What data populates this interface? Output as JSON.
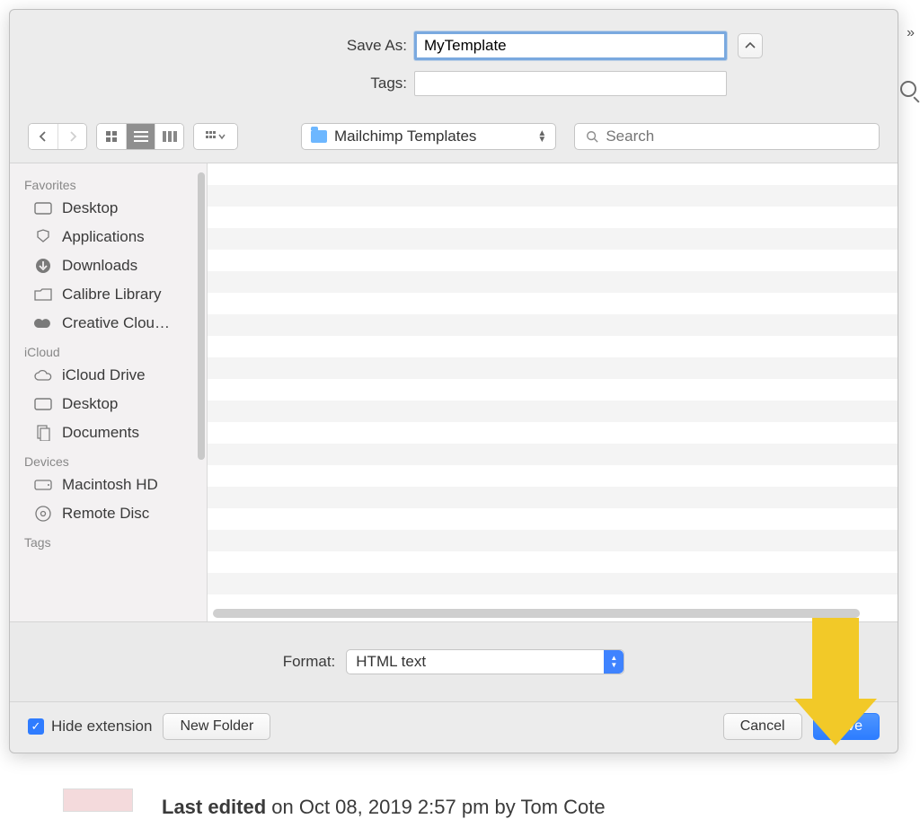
{
  "overflow_indicator": "»",
  "save_row": {
    "label": "Save As:",
    "value": "MyTemplate"
  },
  "tags_row": {
    "label": "Tags:",
    "value": ""
  },
  "toolbar": {
    "folder_name": "Mailchimp Templates",
    "search_placeholder": "Search"
  },
  "sidebar": {
    "sections": [
      {
        "title": "Favorites",
        "items": [
          {
            "icon": "desktop",
            "label": "Desktop"
          },
          {
            "icon": "applications",
            "label": "Applications"
          },
          {
            "icon": "downloads",
            "label": "Downloads"
          },
          {
            "icon": "folder",
            "label": "Calibre Library"
          },
          {
            "icon": "cloud-app",
            "label": "Creative Clou…"
          }
        ]
      },
      {
        "title": "iCloud",
        "items": [
          {
            "icon": "cloud",
            "label": "iCloud Drive"
          },
          {
            "icon": "desktop",
            "label": "Desktop"
          },
          {
            "icon": "documents",
            "label": "Documents"
          }
        ]
      },
      {
        "title": "Devices",
        "items": [
          {
            "icon": "hdd",
            "label": "Macintosh HD"
          },
          {
            "icon": "disc",
            "label": "Remote Disc"
          }
        ]
      },
      {
        "title": "Tags",
        "items": []
      }
    ]
  },
  "format": {
    "label": "Format:",
    "value": "HTML text"
  },
  "bottom": {
    "hide_extension": "Hide extension",
    "new_folder": "New Folder",
    "cancel": "Cancel",
    "save": "Save"
  },
  "background": {
    "last_edited_bold": "Last edited",
    "last_edited_rest": " on Oct 08, 2019 2:57 pm by Tom Cote"
  }
}
